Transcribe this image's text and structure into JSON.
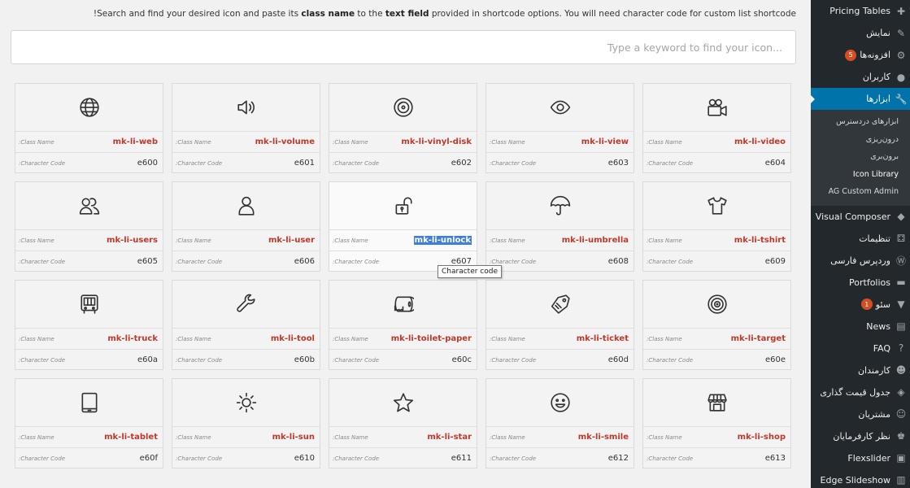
{
  "header": {
    "desc_prefix": "!Search and find your desired icon and paste its ",
    "desc_bold1": "class name",
    "desc_mid": " to the ",
    "desc_bold2": "text field",
    "desc_suffix": " provided in shortcode options. You will need character code for custom list shortcode",
    "search_placeholder": "Type a keyword to find your icon..."
  },
  "grid": {
    "class_label": ":Class Name",
    "code_label": ":Character Code",
    "tooltip": "Character code",
    "icons": [
      {
        "cls": "mk-li-web",
        "code": "e600",
        "icon": "globe-icon"
      },
      {
        "cls": "mk-li-volume",
        "code": "e601",
        "icon": "volume-icon"
      },
      {
        "cls": "mk-li-vinyl-disk",
        "code": "e602",
        "icon": "vinyl-disk-icon"
      },
      {
        "cls": "mk-li-view",
        "code": "e603",
        "icon": "eye-icon"
      },
      {
        "cls": "mk-li-video",
        "code": "e604",
        "icon": "video-camera-icon"
      },
      {
        "cls": "mk-li-users",
        "code": "e605",
        "icon": "users-icon"
      },
      {
        "cls": "mk-li-user",
        "code": "e606",
        "icon": "user-icon"
      },
      {
        "cls": "mk-li-unlock",
        "code": "e607",
        "icon": "unlock-icon"
      },
      {
        "cls": "mk-li-umbrella",
        "code": "e608",
        "icon": "umbrella-icon"
      },
      {
        "cls": "mk-li-tshirt",
        "code": "e609",
        "icon": "tshirt-icon"
      },
      {
        "cls": "mk-li-truck",
        "code": "e60a",
        "icon": "truck-icon"
      },
      {
        "cls": "mk-li-tool",
        "code": "e60b",
        "icon": "wrench-icon"
      },
      {
        "cls": "mk-li-toilet-paper",
        "code": "e60c",
        "icon": "toilet-paper-icon"
      },
      {
        "cls": "mk-li-ticket",
        "code": "e60d",
        "icon": "ticket-icon"
      },
      {
        "cls": "mk-li-target",
        "code": "e60e",
        "icon": "target-icon"
      },
      {
        "cls": "mk-li-tablet",
        "code": "e60f",
        "icon": "tablet-icon"
      },
      {
        "cls": "mk-li-sun",
        "code": "e610",
        "icon": "sun-icon"
      },
      {
        "cls": "mk-li-star",
        "code": "e611",
        "icon": "star-icon"
      },
      {
        "cls": "mk-li-smile",
        "code": "e612",
        "icon": "smile-icon"
      },
      {
        "cls": "mk-li-shop",
        "code": "e613",
        "icon": "shop-icon"
      }
    ]
  },
  "sidebar": {
    "items": [
      {
        "label": "Pricing Tables",
        "icon": "plus-icon"
      },
      {
        "label": "نمایش",
        "icon": "brush-icon"
      },
      {
        "label": "افزونه‌ها",
        "icon": "plugin-icon",
        "badge": "5"
      },
      {
        "label": "کاربران",
        "icon": "user-icon"
      },
      {
        "label": "ابزارها",
        "icon": "wrench-icon",
        "current": true
      }
    ],
    "submenu": [
      {
        "label": "ابزارهای دردسترس"
      },
      {
        "label": "درون‌ریزی"
      },
      {
        "label": "برون‌بری"
      },
      {
        "label": "Icon Library",
        "current": true
      },
      {
        "label": "AG Custom Admin"
      }
    ],
    "items2": [
      {
        "label": "Visual Composer",
        "icon": "vc-icon"
      },
      {
        "label": "تنظیمات",
        "icon": "settings-icon"
      },
      {
        "label": "وردپرس فارسی",
        "icon": "wordpress-icon"
      },
      {
        "label": "Portfolios",
        "icon": "folder-icon"
      },
      {
        "label": "سئو",
        "icon": "yoast-icon",
        "badge": "1"
      },
      {
        "label": "News",
        "icon": "news-icon"
      },
      {
        "label": "FAQ",
        "icon": "help-icon"
      },
      {
        "label": "کارمندان",
        "icon": "groups-icon"
      },
      {
        "label": "جدول قیمت گذاری",
        "icon": "tag-icon"
      },
      {
        "label": "مشتریان",
        "icon": "clients-icon"
      },
      {
        "label": "نظر کارفرمایان",
        "icon": "testimonial-icon"
      },
      {
        "label": "Flexslider",
        "icon": "image-icon"
      },
      {
        "label": "Edge Slideshow",
        "icon": "slides-icon"
      }
    ]
  }
}
